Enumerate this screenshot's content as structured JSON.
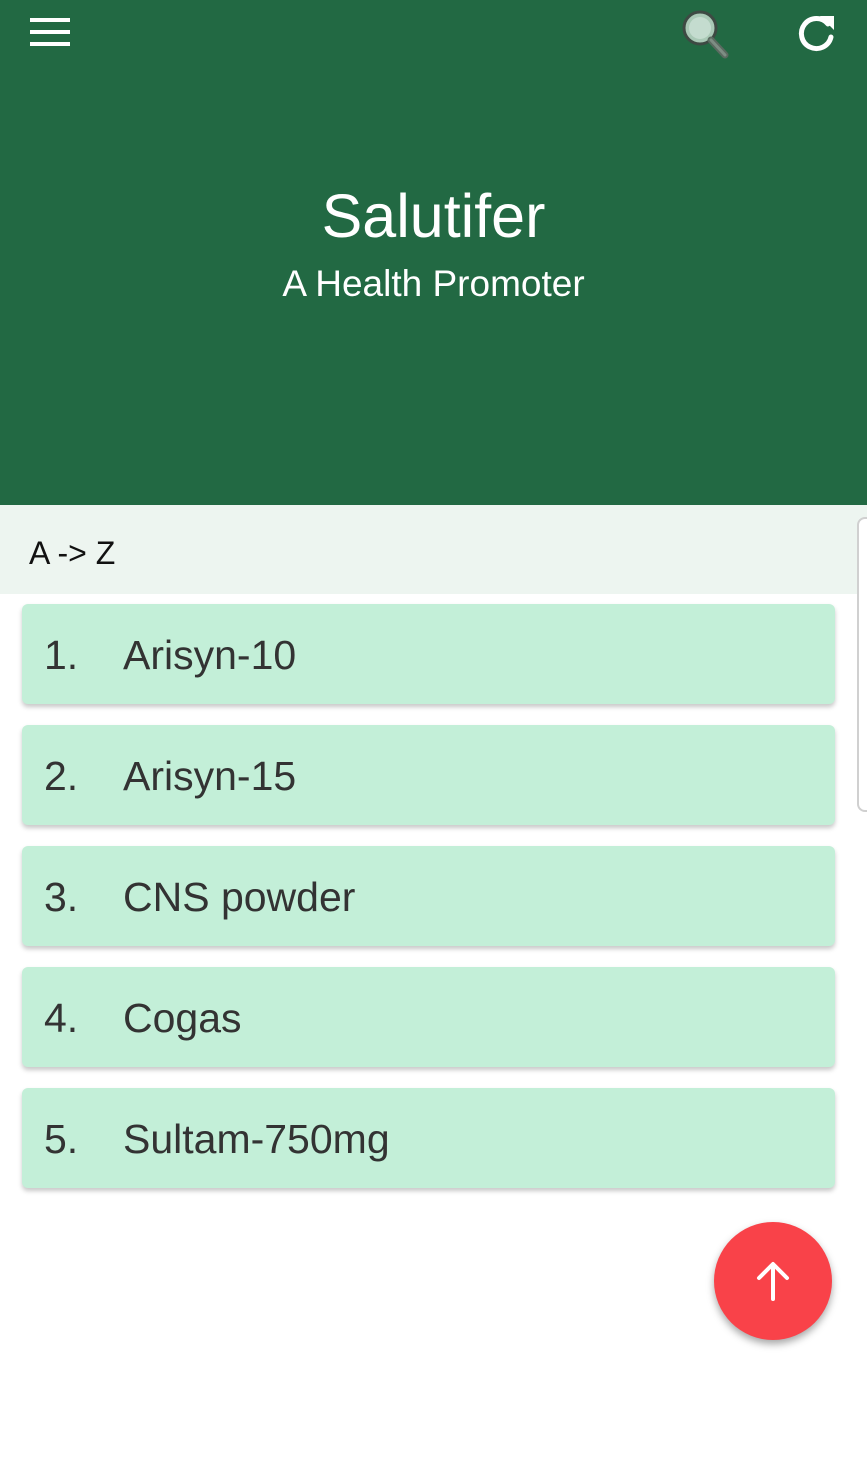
{
  "header": {
    "title": "Salutifer",
    "subtitle": "A Health Promoter",
    "background": "#226943",
    "icons": {
      "menu": "hamburger-menu-icon",
      "search": "magnifier-icon",
      "refresh": "refresh-icon"
    }
  },
  "sort": {
    "label": "A -> Z"
  },
  "items": [
    {
      "number": "1.",
      "name": "Arisyn-10"
    },
    {
      "number": "2.",
      "name": "Arisyn-15"
    },
    {
      "number": "3.",
      "name": "CNS powder"
    },
    {
      "number": "4.",
      "name": "Cogas"
    },
    {
      "number": "5.",
      "name": "Sultam-750mg"
    }
  ],
  "colors": {
    "item_background": "#c3efd8",
    "fab": "#f94249",
    "sort_bar": "#edf5f0"
  },
  "fab": {
    "icon": "arrow-up-icon"
  }
}
